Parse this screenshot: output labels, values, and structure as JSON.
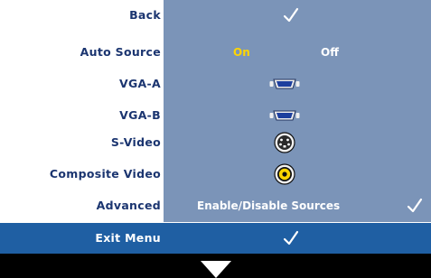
{
  "menu": {
    "items": [
      {
        "label": "Back",
        "value": "check"
      },
      {
        "label": "Auto Source",
        "options": [
          "On",
          "Off"
        ],
        "selected": "On"
      },
      {
        "label": "VGA-A",
        "icon": "vga-connector-icon"
      },
      {
        "label": "VGA-B",
        "icon": "vga-connector-icon"
      },
      {
        "label": "S-Video",
        "icon": "s-video-connector-icon"
      },
      {
        "label": "Composite Video",
        "icon": "composite-video-connector-icon"
      },
      {
        "label": "Advanced",
        "value_text": "Enable/Disable Sources",
        "value": "check"
      }
    ],
    "exit": {
      "label": "Exit Menu",
      "value": "check"
    },
    "scroll_indicator": "down-arrow-icon"
  },
  "colors": {
    "panel": "#7b94b8",
    "label_text": "#1b3570",
    "selected_option": "#ffd500",
    "highlight_bar": "#1f5fa3",
    "footer": "#000000"
  }
}
